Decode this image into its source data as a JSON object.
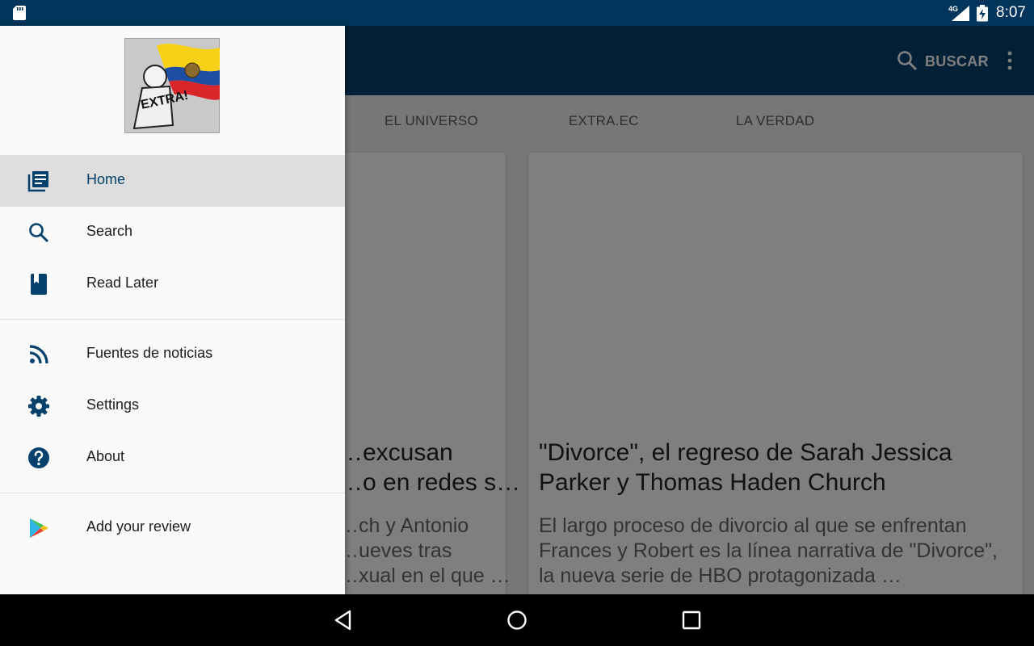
{
  "status_bar": {
    "time": "8:07",
    "network": "4G"
  },
  "app_bar": {
    "search_label": "BUSCAR"
  },
  "tabs": [
    "EL UNIVERSO",
    "EXTRA.EC",
    "LA VERDAD"
  ],
  "cards": [
    {
      "title": "…excusan\n…o en redes s…",
      "description": "…ch y Antonio\n…ueves tras\n…xual en el que …"
    },
    {
      "title": "\"Divorce\", el regreso de Sarah Jessica Parker y Thomas Haden Church",
      "description": "El largo proceso de divorcio al que se enfrentan Frances y Robert es la línea narrativa de \"Divorce\", la nueva serie de HBO protagonizada …"
    }
  ],
  "drawer": {
    "logo_text": "EXTRA!",
    "items": [
      {
        "label": "Home",
        "icon": "newspaper-icon",
        "active": true
      },
      {
        "label": "Search",
        "icon": "search-icon"
      },
      {
        "label": "Read Later",
        "icon": "bookmark-icon"
      },
      {
        "label": "Fuentes de noticias",
        "icon": "rss-icon"
      },
      {
        "label": "Settings",
        "icon": "gear-icon"
      },
      {
        "label": "About",
        "icon": "help-icon"
      },
      {
        "label": "Add your review",
        "icon": "play-store-icon"
      }
    ]
  },
  "colors": {
    "primary_dark": "#02355c",
    "primary": "#04416c",
    "icon": "#04416c"
  }
}
